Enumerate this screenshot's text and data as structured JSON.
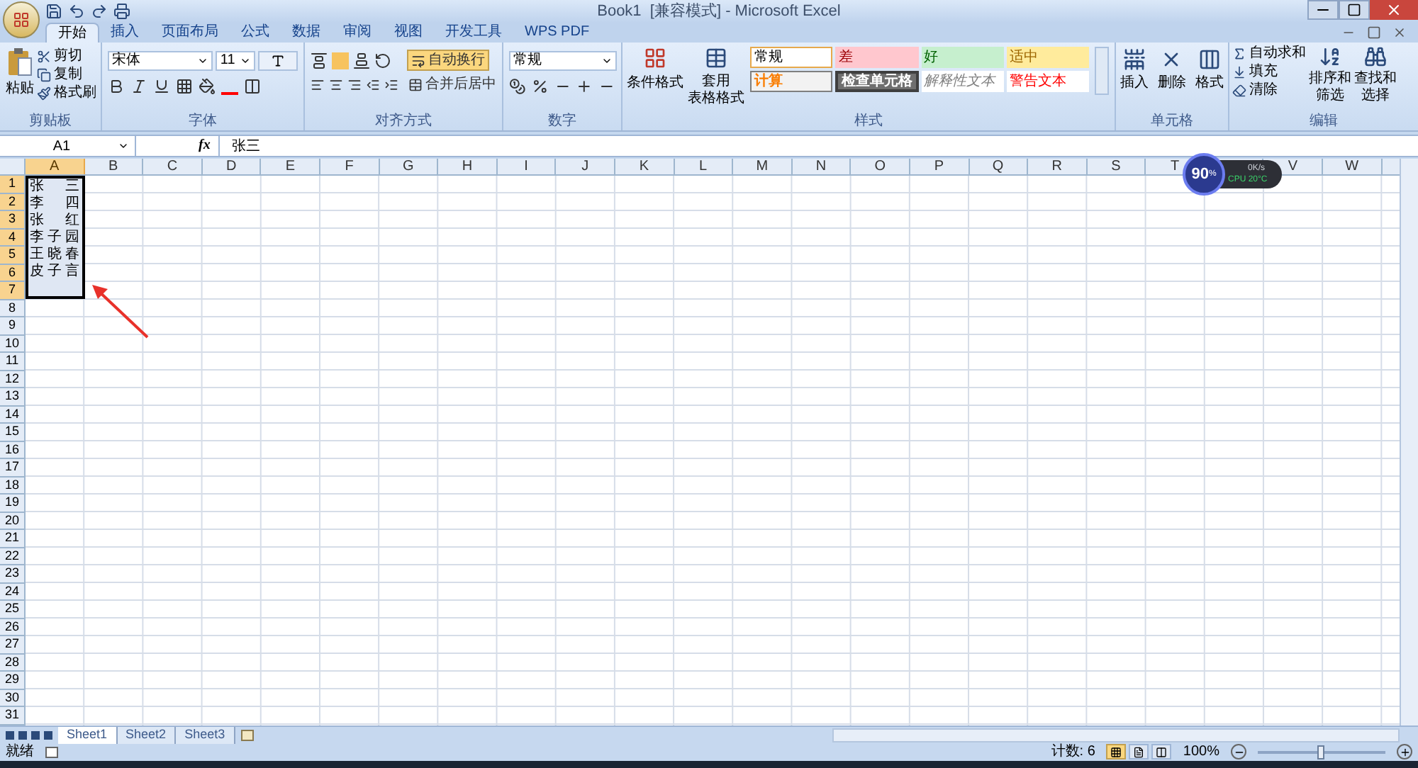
{
  "window": {
    "title": "Book1  [兼容模式] - Microsoft Excel"
  },
  "tabs": [
    {
      "label": "开始",
      "selected": true
    },
    {
      "label": "插入",
      "selected": false
    },
    {
      "label": "页面布局",
      "selected": false
    },
    {
      "label": "公式",
      "selected": false
    },
    {
      "label": "数据",
      "selected": false
    },
    {
      "label": "审阅",
      "selected": false
    },
    {
      "label": "视图",
      "selected": false
    },
    {
      "label": "开发工具",
      "selected": false
    },
    {
      "label": "WPS PDF",
      "selected": false
    }
  ],
  "clipboard": {
    "label": "剪贴板",
    "paste": "粘贴",
    "items": [
      "剪切",
      "复制",
      "格式刷"
    ]
  },
  "font": {
    "label": "字体",
    "name": "宋体",
    "size": "11"
  },
  "alignment": {
    "label": "对齐方式",
    "wrap": {
      "label": "自动换行",
      "selected": true
    },
    "merge": "合并后居中"
  },
  "number": {
    "label": "数字",
    "format": "常规"
  },
  "styles": {
    "label": "样式",
    "conditional": "条件格式",
    "table": [
      "套用",
      "表格格式"
    ],
    "cells": [
      {
        "label": "常规",
        "kind": "normal"
      },
      {
        "label": "差",
        "kind": "bad"
      },
      {
        "label": "好",
        "kind": "good"
      },
      {
        "label": "适中",
        "kind": "neutral"
      },
      {
        "label": "计算",
        "kind": "calculation"
      },
      {
        "label": "检查单元格",
        "kind": "check"
      },
      {
        "label": "解释性文本",
        "kind": "explanatory"
      },
      {
        "label": "警告文本",
        "kind": "warning"
      }
    ]
  },
  "cells_group": {
    "label": "单元格",
    "items": [
      "插入",
      "删除",
      "格式"
    ]
  },
  "editing": {
    "label": "编辑",
    "items": [
      "自动求和",
      "填充",
      "清除"
    ],
    "sort": [
      "排序和",
      "筛选"
    ],
    "find": [
      "查找和",
      "选择"
    ]
  },
  "formula_bar": {
    "name_box": "A1",
    "fx": "fx",
    "formula": "张三"
  },
  "columns": [
    {
      "label": "A",
      "selected": true
    },
    {
      "label": "B",
      "selected": false
    },
    {
      "label": "C",
      "selected": false
    },
    {
      "label": "D",
      "selected": false
    },
    {
      "label": "E",
      "selected": false
    },
    {
      "label": "F",
      "selected": false
    },
    {
      "label": "G",
      "selected": false
    },
    {
      "label": "H",
      "selected": false
    },
    {
      "label": "I",
      "selected": false
    },
    {
      "label": "J",
      "selected": false
    },
    {
      "label": "K",
      "selected": false
    },
    {
      "label": "L",
      "selected": false
    },
    {
      "label": "M",
      "selected": false
    },
    {
      "label": "N",
      "selected": false
    },
    {
      "label": "O",
      "selected": false
    },
    {
      "label": "P",
      "selected": false
    },
    {
      "label": "Q",
      "selected": false
    },
    {
      "label": "R",
      "selected": false
    },
    {
      "label": "S",
      "selected": false
    },
    {
      "label": "T",
      "selected": false
    },
    {
      "selected": false
    },
    {
      "label": "V",
      "selected": false
    },
    {
      "label": "W",
      "selected": false
    }
  ],
  "rows": [
    {
      "header": "1",
      "value": "张三",
      "selected": true
    },
    {
      "header": "2",
      "value": "李四",
      "selected": true
    },
    {
      "header": "3",
      "value": "张红",
      "selected": true
    },
    {
      "header": "4",
      "value": "李子园",
      "selected": true
    },
    {
      "header": "5",
      "value": "王晓春",
      "selected": true
    },
    {
      "header": "6",
      "value": "皮子言",
      "selected": true
    },
    {
      "header": "7",
      "selected": true
    },
    {
      "header": "8",
      "selected": false
    },
    {
      "header": "9",
      "selected": false
    },
    {
      "header": "10",
      "selected": false
    },
    {
      "header": "11",
      "selected": false
    },
    {
      "header": "12",
      "selected": false
    },
    {
      "header": "13",
      "selected": false
    },
    {
      "header": "14",
      "selected": false
    },
    {
      "header": "15",
      "selected": false
    },
    {
      "header": "16",
      "selected": false
    },
    {
      "header": "17",
      "selected": false
    },
    {
      "header": "18",
      "selected": false
    },
    {
      "header": "19",
      "selected": false
    },
    {
      "header": "20",
      "selected": false
    },
    {
      "header": "21",
      "selected": false
    },
    {
      "header": "22",
      "selected": false
    },
    {
      "header": "23",
      "selected": false
    },
    {
      "header": "24",
      "selected": false
    },
    {
      "header": "25",
      "selected": false
    },
    {
      "header": "26",
      "selected": false
    },
    {
      "header": "27",
      "selected": false
    },
    {
      "header": "28",
      "selected": false
    },
    {
      "header": "29",
      "selected": false
    },
    {
      "header": "30",
      "selected": false
    },
    {
      "header": "31",
      "selected": false
    }
  ],
  "monitor": {
    "value": "90",
    "unit": "%",
    "speed": "0K/s",
    "cpu": "CPU 20°C"
  },
  "sheets": [
    {
      "label": "Sheet1",
      "selected": true
    },
    {
      "label": "Sheet2",
      "selected": false
    },
    {
      "label": "Sheet3",
      "selected": false
    }
  ],
  "status_bar": {
    "state": "就绪",
    "count": "计数: 6",
    "zoom": "100%",
    "zoom_slider": {
      "level": 0.5
    },
    "views": [
      {
        "kind": "normal",
        "selected": true
      },
      {
        "kind": "layout",
        "selected": false
      },
      {
        "kind": "pagebreak",
        "selected": false
      }
    ]
  }
}
